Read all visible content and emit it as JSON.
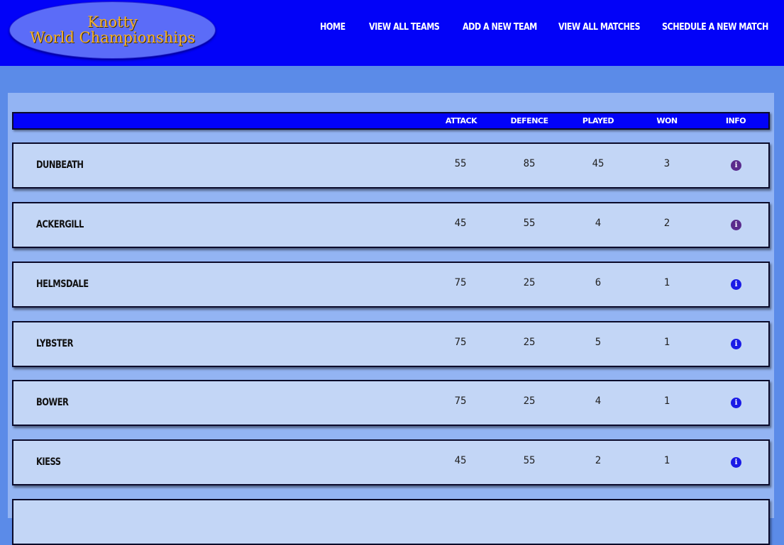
{
  "logo": {
    "line1": "Knotty",
    "line2": "World Championships"
  },
  "nav": [
    {
      "label": "Home"
    },
    {
      "label": "View all teams"
    },
    {
      "label": "Add a new team"
    },
    {
      "label": "View all matches"
    },
    {
      "label": "Schedule a new match"
    }
  ],
  "table": {
    "headers": {
      "attack": "Attack",
      "defence": "Defence",
      "played": "Played",
      "won": "Won",
      "info": "Info"
    },
    "rows": [
      {
        "team": "Dunbeath",
        "attack": "55",
        "defence": "85",
        "played": "45",
        "won": "3",
        "info_icon": "info-circle-icon",
        "info_color": "#5a2a8c"
      },
      {
        "team": "Ackergill",
        "attack": "45",
        "defence": "55",
        "played": "4",
        "won": "2",
        "info_icon": "info-circle-icon",
        "info_color": "#5a2a8c"
      },
      {
        "team": "Helmsdale",
        "attack": "75",
        "defence": "25",
        "played": "6",
        "won": "1",
        "info_icon": "info-circle-icon",
        "info_color": "#1a1ae6"
      },
      {
        "team": "Lybster",
        "attack": "75",
        "defence": "25",
        "played": "5",
        "won": "1",
        "info_icon": "info-circle-icon",
        "info_color": "#1a1ae6"
      },
      {
        "team": "Bower",
        "attack": "75",
        "defence": "25",
        "played": "4",
        "won": "1",
        "info_icon": "info-circle-icon",
        "info_color": "#1a1ae6"
      },
      {
        "team": "Kiess",
        "attack": "45",
        "defence": "55",
        "played": "2",
        "won": "1",
        "info_icon": "info-circle-icon",
        "info_color": "#1a1ae6"
      }
    ]
  },
  "colors": {
    "header_bg": "#0202f8",
    "page_bg": "#5b8be8",
    "panel_bg": "#93b4f3",
    "row_bg": "#c3d6f6",
    "logo_text": "#f4b12e"
  }
}
